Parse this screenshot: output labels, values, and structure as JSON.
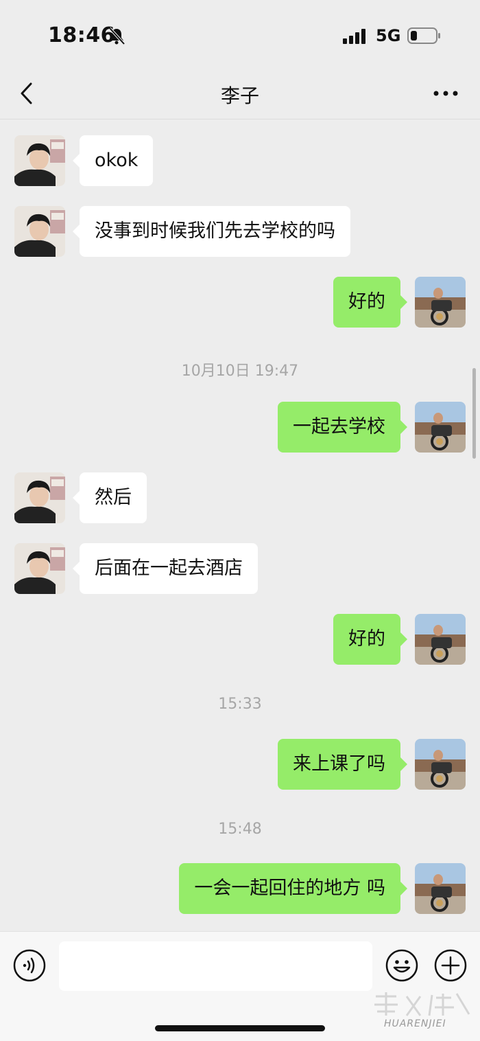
{
  "status_bar": {
    "time": "18:46",
    "network": "5G"
  },
  "header": {
    "title": "李子"
  },
  "messages": [
    {
      "side": "left",
      "text": "okok"
    },
    {
      "side": "left",
      "text": "没事到时候我们先去学校的吗"
    },
    {
      "side": "right",
      "text": "好的"
    },
    {
      "timestamp": "10月10日 19:47"
    },
    {
      "side": "right",
      "text": "一起去学校"
    },
    {
      "side": "left",
      "text": "然后"
    },
    {
      "side": "left",
      "text": "后面在一起去酒店"
    },
    {
      "side": "right",
      "text": "好的"
    },
    {
      "timestamp": "15:33"
    },
    {
      "side": "right",
      "text": "来上课了吗"
    },
    {
      "timestamp": "15:48"
    },
    {
      "side": "right",
      "text": "一会一起回住的地方 吗"
    }
  ],
  "input": {
    "value": ""
  },
  "watermark": {
    "text": "HUARENJIEI"
  },
  "colors": {
    "background": "#ededed",
    "self_bubble": "#95ec69",
    "other_bubble": "#ffffff",
    "timestamp_text": "#a6a6a6"
  }
}
